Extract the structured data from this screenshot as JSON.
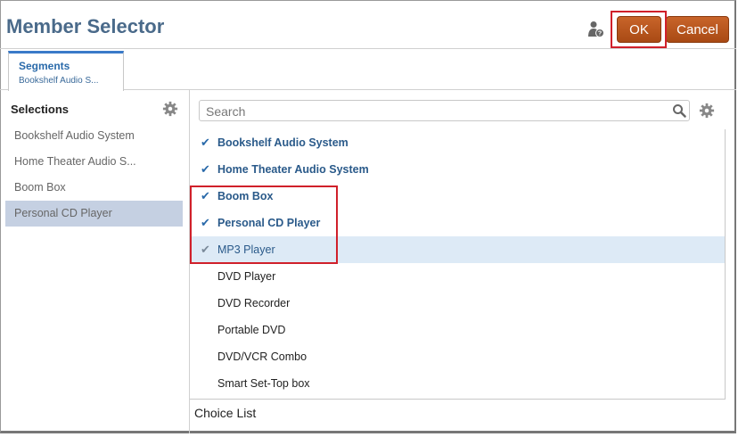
{
  "header": {
    "title": "Member Selector",
    "ok_label": "OK",
    "cancel_label": "Cancel"
  },
  "tabs": [
    {
      "title": "Segments",
      "subtitle": "Bookshelf Audio S..."
    }
  ],
  "selections": {
    "heading": "Selections",
    "items": [
      {
        "label": "Bookshelf Audio System",
        "active": false
      },
      {
        "label": "Home Theater Audio S...",
        "active": false
      },
      {
        "label": "Boom Box",
        "active": false
      },
      {
        "label": "Personal CD Player",
        "active": true
      }
    ]
  },
  "search": {
    "placeholder": "Search",
    "value": ""
  },
  "members": [
    {
      "label": "Bookshelf Audio System",
      "checked": true
    },
    {
      "label": "Home Theater Audio System",
      "checked": true
    },
    {
      "label": "Boom Box",
      "checked": true
    },
    {
      "label": "Personal CD Player",
      "checked": true
    },
    {
      "label": "MP3 Player",
      "checked": true,
      "hover": true
    },
    {
      "label": "DVD Player",
      "checked": false
    },
    {
      "label": "DVD Recorder",
      "checked": false
    },
    {
      "label": "Portable DVD",
      "checked": false
    },
    {
      "label": "DVD/VCR Combo",
      "checked": false
    },
    {
      "label": "Smart Set-Top box",
      "checked": false
    }
  ],
  "footer": {
    "label": "Choice List"
  },
  "icons": {
    "user": "user-info-icon",
    "gear": "gear-icon",
    "search": "search-icon",
    "check": "checkmark-icon"
  },
  "colors": {
    "title": "#4a6a8a",
    "button": "#b5541c",
    "highlight": "#d0202a",
    "selected_row": "#c5d0e2",
    "hover_row": "#ddeaf6",
    "link_blue": "#2a6aaa"
  }
}
